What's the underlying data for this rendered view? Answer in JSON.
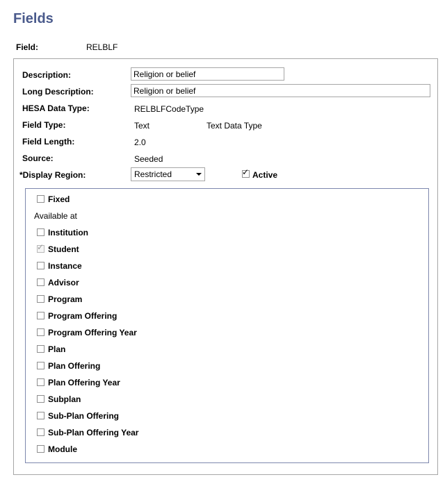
{
  "page": {
    "title": "Fields"
  },
  "field": {
    "label": "Field:",
    "value": "RELBLF"
  },
  "form": {
    "description": {
      "label": "Description:",
      "value": "Religion or belief"
    },
    "long_description": {
      "label": "Long Description:",
      "value": "Religion or belief"
    },
    "hesa_data_type": {
      "label": "HESA Data Type:",
      "value": "RELBLFCodeType"
    },
    "field_type": {
      "label": "Field Type:",
      "value": "Text",
      "extra": "Text Data Type"
    },
    "field_length": {
      "label": "Field Length:",
      "value": "2.0"
    },
    "source": {
      "label": "Source:",
      "value": "Seeded"
    },
    "display_region": {
      "label": "*Display Region:",
      "value": "Restricted"
    },
    "active": {
      "label": "Active",
      "checked": true
    }
  },
  "availability": {
    "fixed": {
      "label": "Fixed",
      "checked": false
    },
    "available_at_label": "Available at",
    "items": [
      {
        "label": "Institution",
        "checked": false
      },
      {
        "label": "Student",
        "checked": true
      },
      {
        "label": "Instance",
        "checked": false
      },
      {
        "label": "Advisor",
        "checked": false
      },
      {
        "label": "Program",
        "checked": false
      },
      {
        "label": "Program Offering",
        "checked": false
      },
      {
        "label": "Program Offering Year",
        "checked": false
      },
      {
        "label": "Plan",
        "checked": false
      },
      {
        "label": "Plan Offering",
        "checked": false
      },
      {
        "label": "Plan Offering Year",
        "checked": false
      },
      {
        "label": "Subplan",
        "checked": false
      },
      {
        "label": "Sub-Plan Offering",
        "checked": false
      },
      {
        "label": "Sub-Plan Offering Year",
        "checked": false
      },
      {
        "label": "Module",
        "checked": false
      }
    ]
  }
}
